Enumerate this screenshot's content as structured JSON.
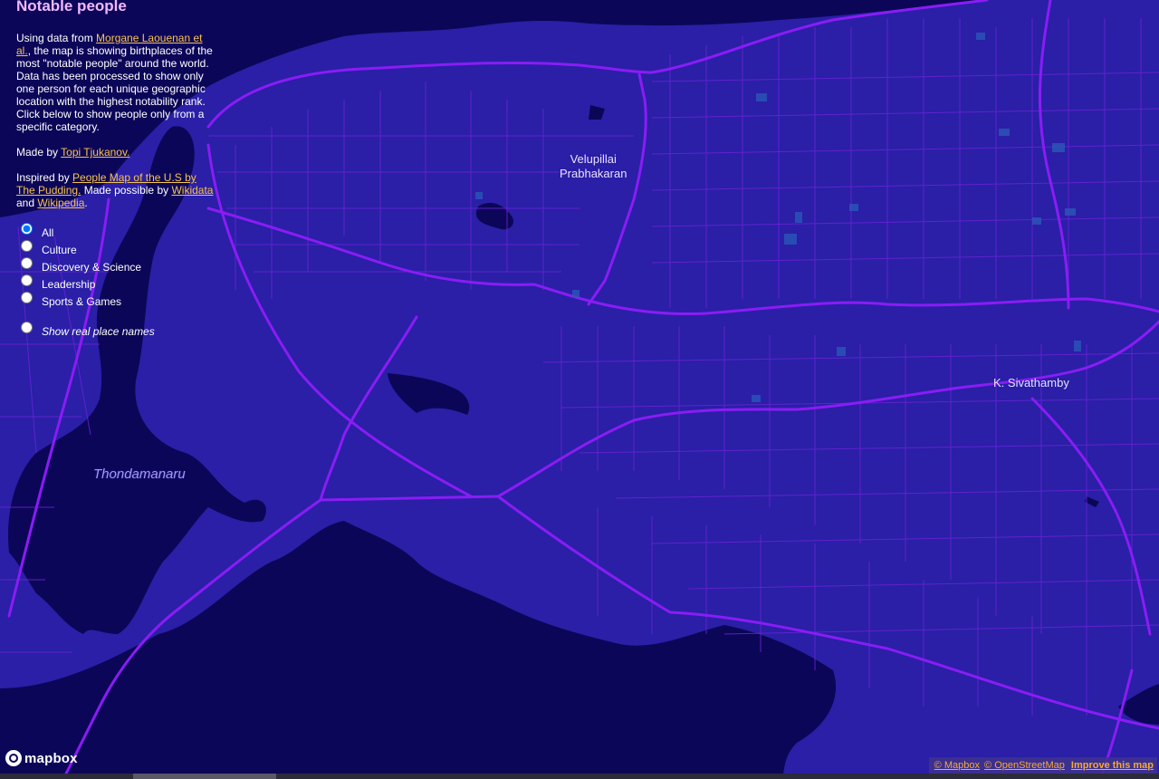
{
  "panel": {
    "title": "Notable people",
    "intro_prefix": "Using data from ",
    "intro_link": "Morgane Laouenan et al.",
    "intro_suffix": ", the map is showing birthplaces of the most \"notable people\" around the world. Data has been processed to show only one person for each unique geographic location with the highest notability rank. Click below to show people only from a specific category.",
    "made_prefix": "Made by ",
    "made_link": "Topi Tjukanov.",
    "inspired_prefix": "Inspired by ",
    "inspired_link1": "People Map of the U.S by The Pudding.",
    "inspired_mid": " Made possible by ",
    "inspired_link2": "Wikidata",
    "inspired_and": " and ",
    "inspired_link3": "Wikipedia",
    "inspired_end": ".",
    "categories": [
      "All",
      "Culture",
      "Discovery & Science",
      "Leadership",
      "Sports & Games"
    ],
    "selected_category": "All",
    "real_names_label": "Show real place names"
  },
  "map": {
    "labels": {
      "velu_line1": "Velupillai",
      "velu_line2": "Prabhakaran",
      "siva": "K. Sivathamby",
      "place": "Thondamanaru"
    },
    "colors": {
      "land": "#2a1fa6",
      "water": "#0c0658",
      "roads": "#8a1cf5",
      "labels": "#e8e0ff"
    }
  },
  "branding": {
    "logo_text": "mapbox",
    "logo_icon": "mapbox-logo-icon"
  },
  "attribution": {
    "mapbox": "© Mapbox",
    "osm": "© OpenStreetMap",
    "improve": "Improve this map"
  }
}
